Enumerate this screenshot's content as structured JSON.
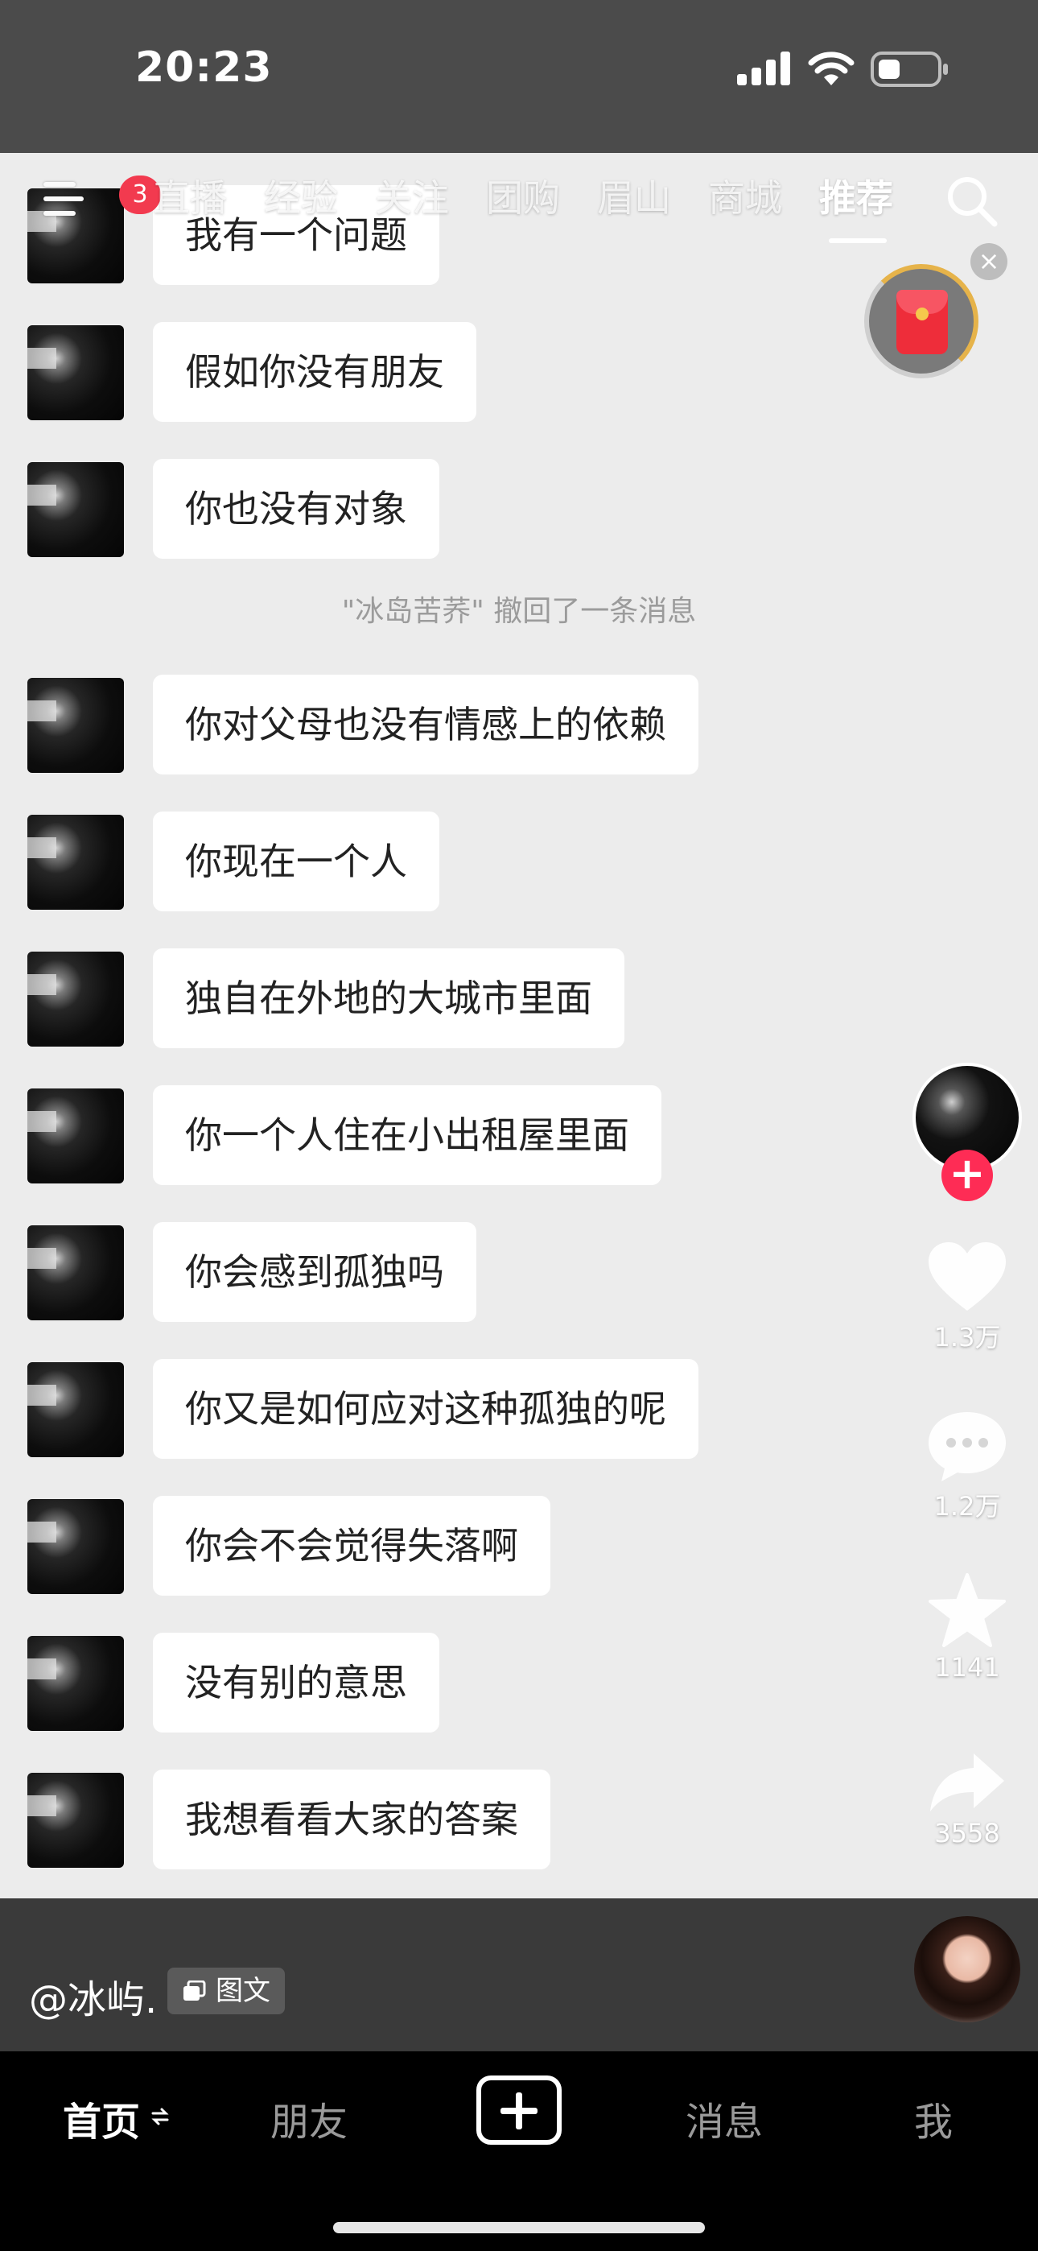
{
  "status_bar": {
    "time": "20:23"
  },
  "top_nav": {
    "badge_count": "3",
    "tabs": [
      {
        "label": "直播"
      },
      {
        "label": "经验"
      },
      {
        "label": "关注"
      },
      {
        "label": "团购"
      },
      {
        "label": "眉山"
      },
      {
        "label": "商城"
      },
      {
        "label": "推荐",
        "active": true
      }
    ]
  },
  "chat": {
    "messages": [
      "我有一个问题",
      "假如你没有朋友",
      "你也没有对象",
      "你对父母也没有情感上的依赖",
      "你现在一个人",
      "独自在外地的大城市里面",
      "你一个人住在小出租屋里面",
      "你会感到孤独吗",
      "你又是如何应对这种孤独的呢",
      "你会不会觉得失落啊",
      "没有别的意思",
      "我想看看大家的答案"
    ],
    "recall_notice": "\"冰岛苦荞\" 撤回了一条消息"
  },
  "rail": {
    "likes": "1.3万",
    "comments": "1.2万",
    "favorites": "1141",
    "shares": "3558"
  },
  "caption": {
    "author": "@冰屿.",
    "tag": "图文"
  },
  "bottom_bar": {
    "home": "首页",
    "friends": "朋友",
    "messages": "消息",
    "me": "我"
  },
  "colors": {
    "accent": "#fe2c55",
    "badge": "#f23a4f",
    "bubble": "#ffffff"
  }
}
